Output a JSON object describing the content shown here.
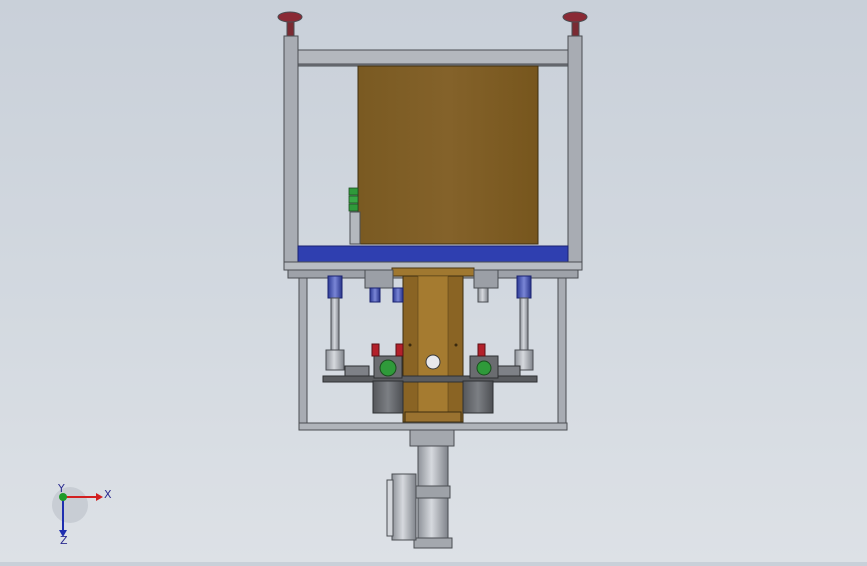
{
  "viewport": {
    "background_top": "#c9d0d9",
    "background_bottom": "#dde1e6"
  },
  "model": {
    "frame_color": "#a9adb4",
    "plate_color": "#2f3fb0",
    "box_color": "#7b5a20",
    "motor_color": "#6a6c70",
    "accent_green": "#2f9a3a",
    "accent_red": "#b3202a",
    "accent_blue": "#3c4fb8"
  },
  "triad": {
    "x_label": "X",
    "y_label": "Y",
    "z_label": "Z",
    "x_color": "#d22020",
    "y_color": "#1f9a2a",
    "z_color": "#1f2fb0"
  }
}
